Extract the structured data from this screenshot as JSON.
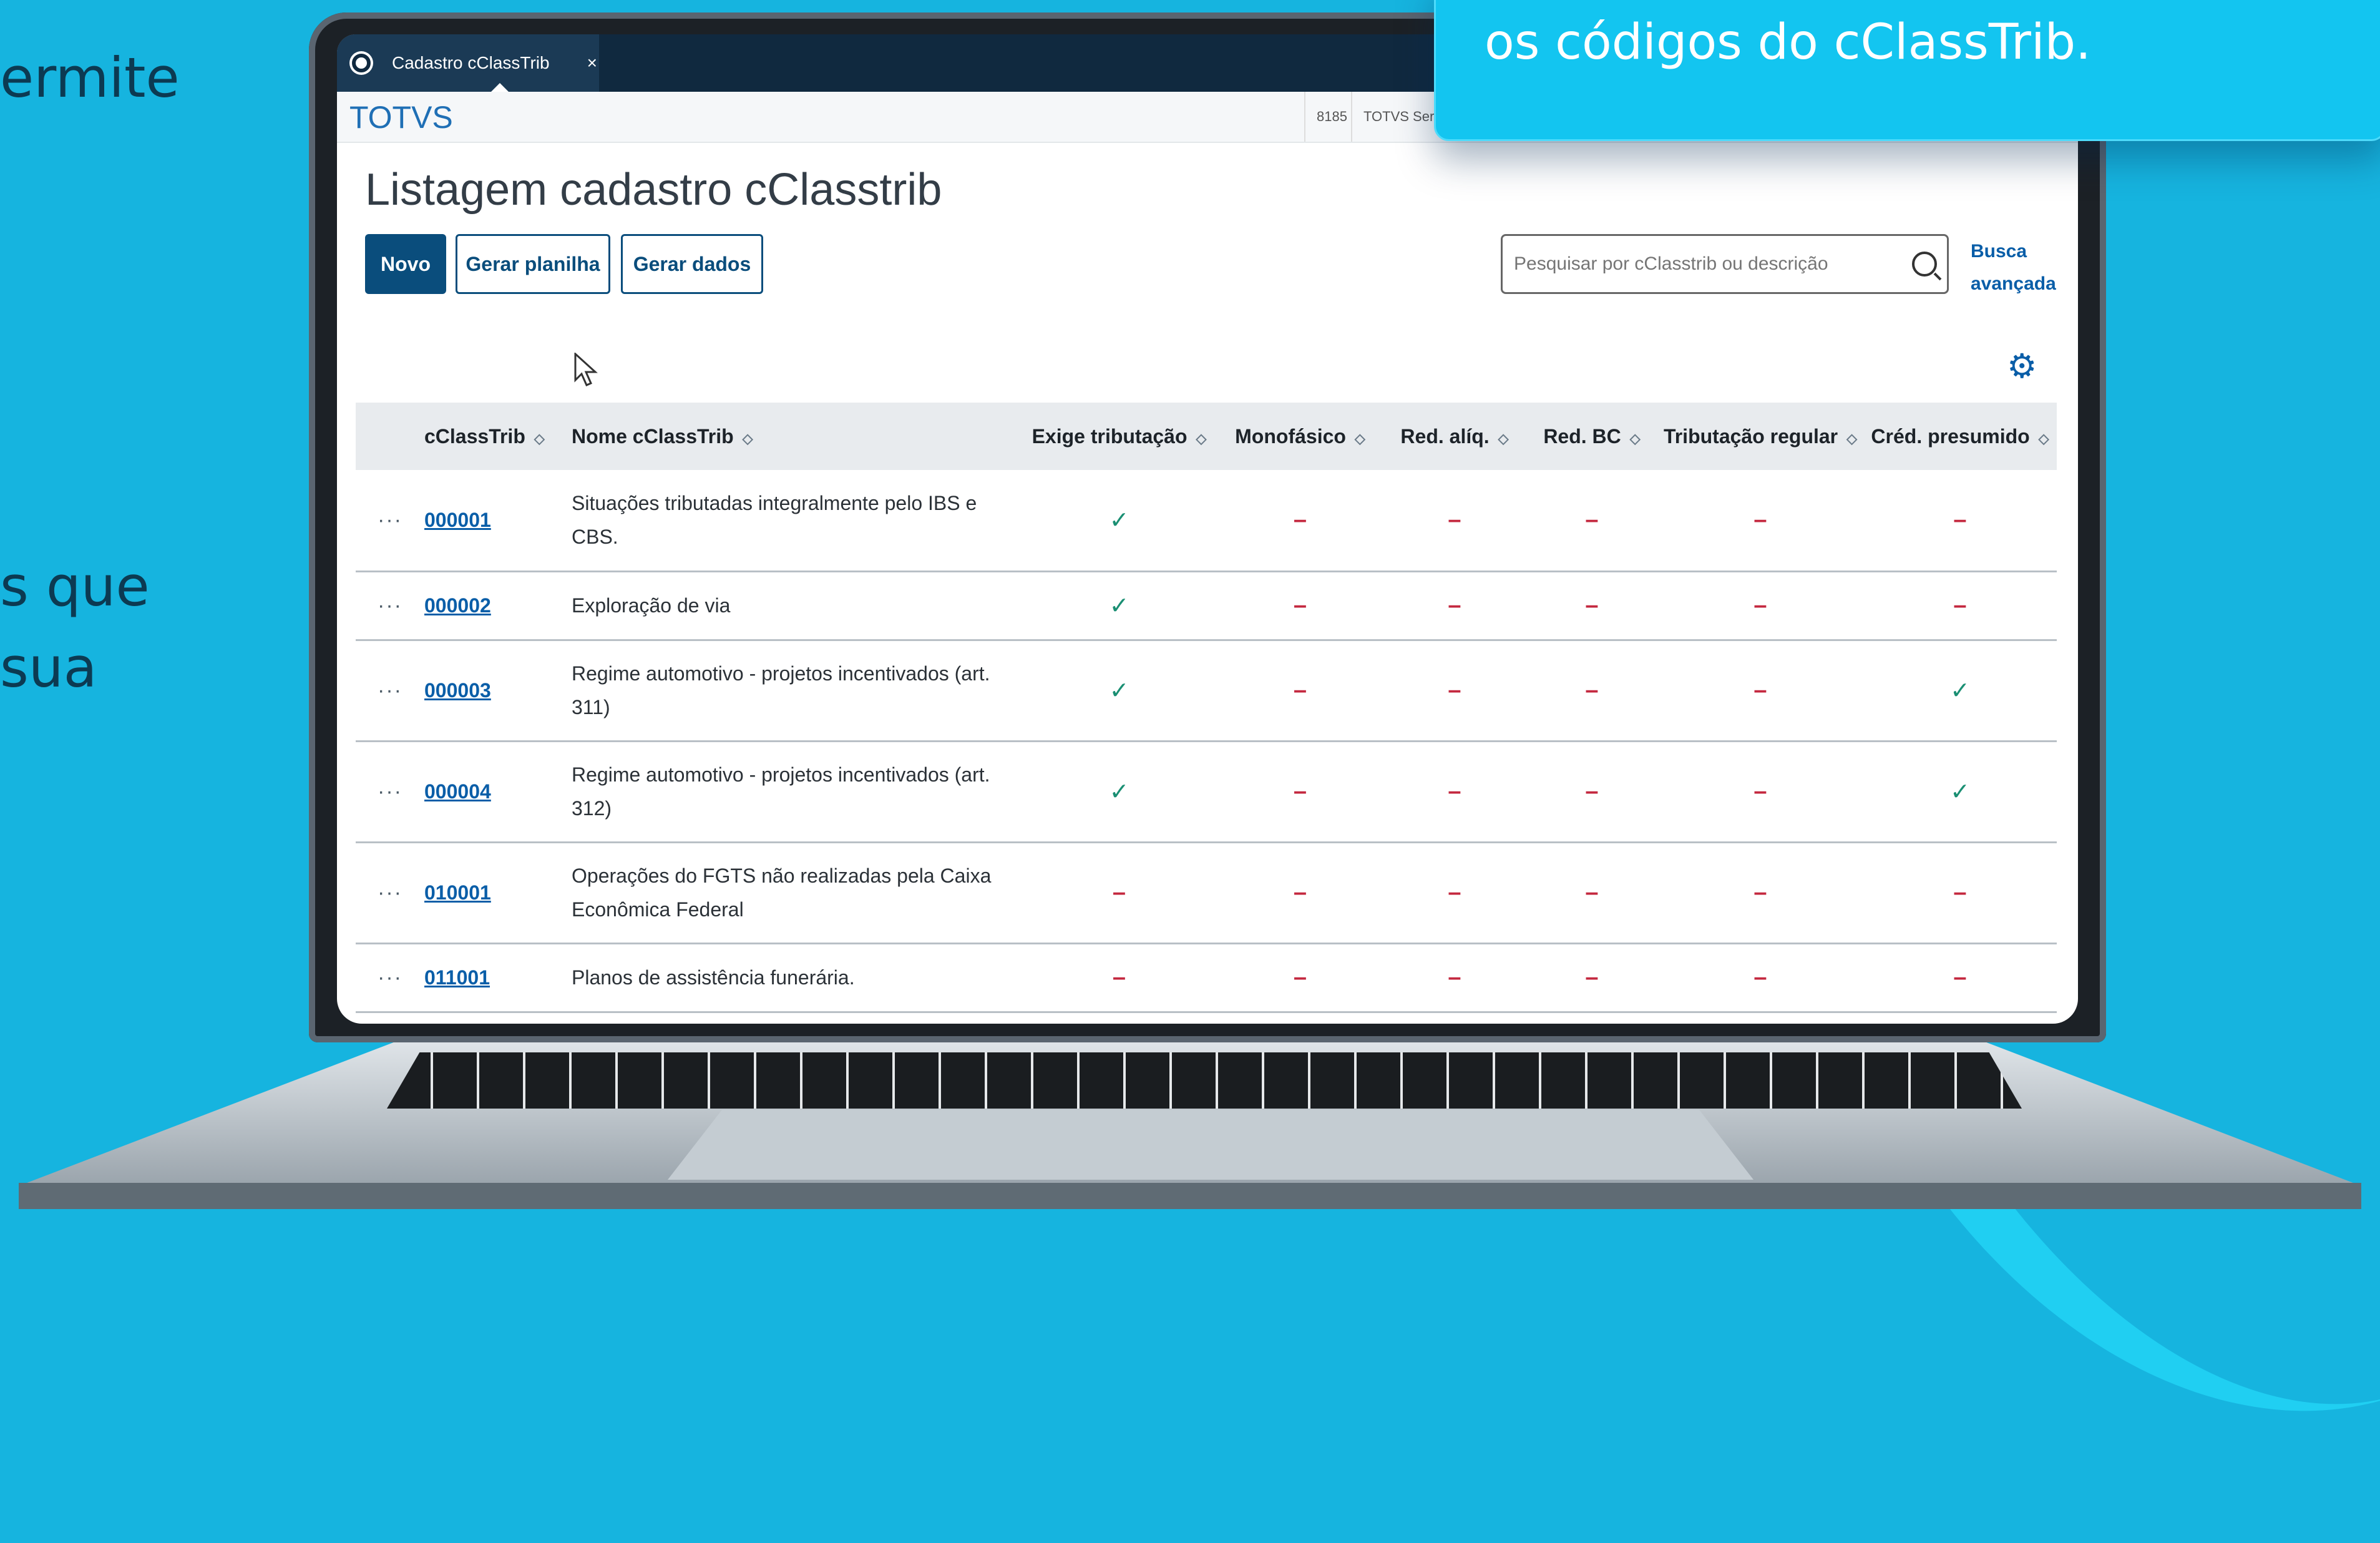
{
  "background_text": {
    "line1": "ermite",
    "line2": "s que",
    "line3": " sua"
  },
  "callout": {
    "text": "os códigos do cClassTrib."
  },
  "browser": {
    "tab_title": "Cadastro cClassTrib",
    "tab_close": "×"
  },
  "appbar": {
    "brand": "TOTVS",
    "code": "8185",
    "env": "TOTVS Serv"
  },
  "page": {
    "title": "Listagem cadastro cClasstrib",
    "btn_new": "Novo",
    "btn_sheet": "Gerar planilha",
    "btn_data": "Gerar dados",
    "search_placeholder": "Pesquisar por cClasstrib ou descrição",
    "advanced_search": "Busca avançada"
  },
  "table": {
    "headers": [
      "cClassTrib",
      "Nome cClassTrib",
      "Exige tributação",
      "Monofásico",
      "Red. alíq.",
      "Red. BC",
      "Tributação regular",
      "Créd. presumido"
    ],
    "rows": [
      {
        "code": "000001",
        "name": "Situações tributadas integralmente pelo IBS e CBS.",
        "flags": [
          "✓",
          "–",
          "–",
          "–",
          "–",
          "–"
        ]
      },
      {
        "code": "000002",
        "name": "Exploração de via",
        "flags": [
          "✓",
          "–",
          "–",
          "–",
          "–",
          "–"
        ]
      },
      {
        "code": "000003",
        "name": "Regime automotivo - projetos incentivados (art. 311)",
        "flags": [
          "✓",
          "–",
          "–",
          "–",
          "–",
          "✓"
        ]
      },
      {
        "code": "000004",
        "name": "Regime automotivo - projetos incentivados (art. 312)",
        "flags": [
          "✓",
          "–",
          "–",
          "–",
          "–",
          "✓"
        ]
      },
      {
        "code": "010001",
        "name": "Operações do FGTS não realizadas pela Caixa Econômica Federal",
        "flags": [
          "–",
          "–",
          "–",
          "–",
          "–",
          "–"
        ]
      },
      {
        "code": "011001",
        "name": "Planos de assistência funerária.",
        "flags": [
          "–",
          "–",
          "–",
          "–",
          "–",
          "–"
        ]
      }
    ],
    "row_action": "···"
  },
  "colors": {
    "background": "#16b4df",
    "primary": "#0a4d7c",
    "check": "#1a8f73",
    "dash": "#c4283f"
  }
}
